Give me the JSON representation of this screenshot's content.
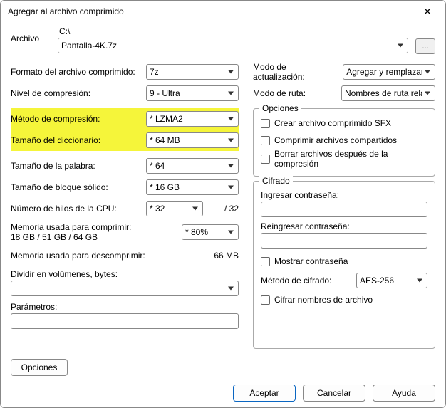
{
  "window": {
    "title": "Agregar al archivo comprimido"
  },
  "file": {
    "label": "Archivo",
    "path": "C:\\",
    "name": "Pantalla-4K.7z",
    "browse": "..."
  },
  "left": {
    "format_label": "Formato del archivo comprimido:",
    "format_value": "7z",
    "level_label": "Nivel de compresión:",
    "level_value": "9 - Ultra",
    "method_label": "Método de compresión:",
    "method_value": "*  LZMA2",
    "dict_label": "Tamaño del diccionario:",
    "dict_value": "*  64 MB",
    "word_label": "Tamaño de la palabra:",
    "word_value": "*  64",
    "block_label": "Tamaño de bloque sólido:",
    "block_value": "*  16 GB",
    "threads_label": "Número de hilos de la CPU:",
    "threads_value": "*  32",
    "threads_total": "/ 32",
    "mem_comp_label": "Memoria usada para comprimir:",
    "mem_comp_value": "18 GB / 51 GB / 64 GB",
    "mem_comp_pct": "*  80%",
    "mem_decomp_label": "Memoria usada para descomprimir:",
    "mem_decomp_value": "66 MB",
    "split_label": "Dividir en volúmenes, bytes:",
    "params_label": "Parámetros:"
  },
  "right": {
    "update_label": "Modo de actualización:",
    "update_value": "Agregar y remplazar archivos",
    "path_label": "Modo de ruta:",
    "path_value": "Nombres de ruta relativos",
    "options_legend": "Opciones",
    "opt_sfx": "Crear archivo comprimido SFX",
    "opt_shared": "Comprimir archivos compartidos",
    "opt_delete": "Borrar archivos después de la compresión",
    "encrypt_legend": "Cifrado",
    "pwd_label": "Ingresar contraseña:",
    "pwd2_label": "Reingresar contraseña:",
    "show_pwd": "Mostrar contraseña",
    "enc_method_label": "Método de cifrado:",
    "enc_method_value": "AES-256",
    "enc_names": "Cifrar nombres de archivo"
  },
  "buttons": {
    "options": "Opciones",
    "ok": "Aceptar",
    "cancel": "Cancelar",
    "help": "Ayuda"
  }
}
